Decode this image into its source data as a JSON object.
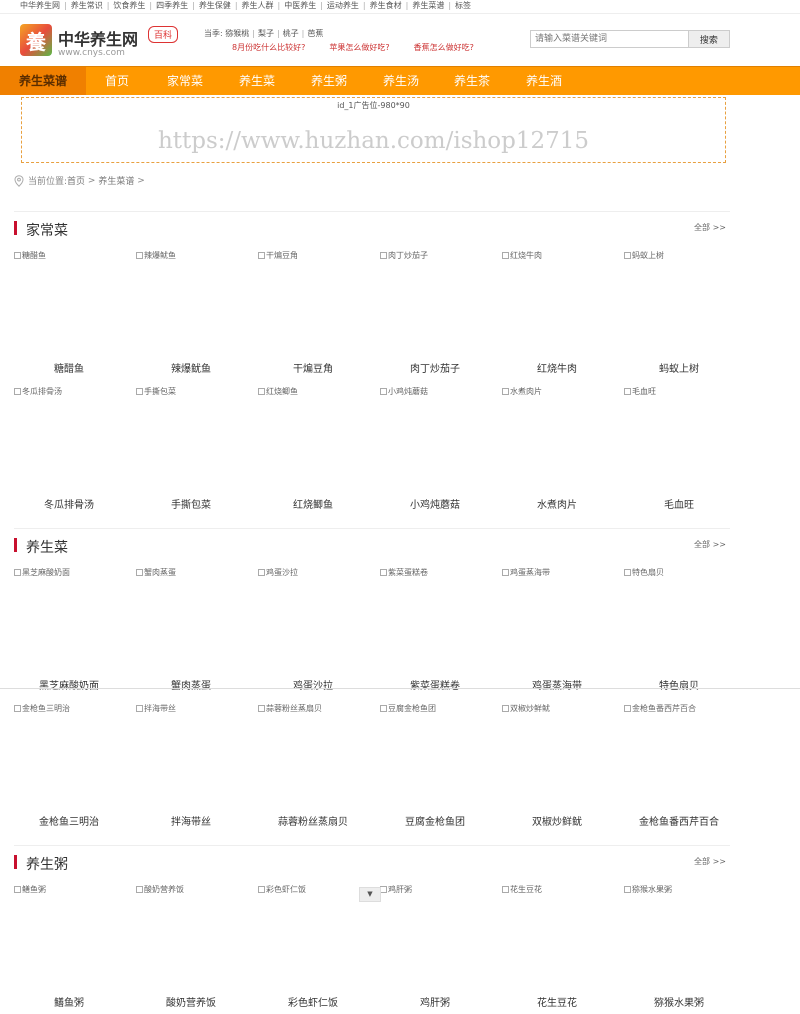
{
  "topbar": [
    "中华养生网",
    "养生常识",
    "饮食养生",
    "四季养生",
    "养生保健",
    "养生人群",
    "中医养生",
    "运动养生",
    "养生食材",
    "养生菜谱",
    "标签"
  ],
  "logo": {
    "mark": "養",
    "name": "中华养生网",
    "url": "www.cnys.com",
    "badge": "百科"
  },
  "hot": {
    "label": "当季:",
    "items": [
      "猕猴桃",
      "梨子",
      "桃子",
      "芭蕉"
    ],
    "questions": [
      "8月份吃什么比较好?",
      "苹果怎么做好吃?",
      "香蕉怎么做好吃?"
    ]
  },
  "search": {
    "placeholder": "请输入菜谱关键词",
    "button": "搜索"
  },
  "nav": [
    "养生菜谱",
    "首页",
    "家常菜",
    "养生菜",
    "养生粥",
    "养生汤",
    "养生茶",
    "养生酒"
  ],
  "ad": {
    "label": "id_1广告位-980*90",
    "watermark": "https://www.huzhan.com/ishop12715"
  },
  "breadcrumb": {
    "prefix": "当前位置:",
    "home": "首页",
    "sep": " > ",
    "current": "养生菜谱",
    "trail": " >"
  },
  "sections": [
    {
      "title": "家常菜",
      "more": "全部 >>",
      "rows": [
        [
          "糖醋鱼",
          "辣爆鱿鱼",
          "干煸豆角",
          "肉丁炒茄子",
          "红烧牛肉",
          "蚂蚁上树"
        ],
        [
          "冬瓜排骨汤",
          "手撕包菜",
          "红烧鲫鱼",
          "小鸡炖蘑菇",
          "水煮肉片",
          "毛血旺"
        ]
      ]
    },
    {
      "title": "养生菜",
      "more": "全部 >>",
      "rows": [
        [
          "黑芝麻酸奶面",
          "蟹肉蒸蛋",
          "鸡蛋沙拉",
          "紫菜蛋糕卷",
          "鸡蛋蒸海带",
          "特色扇贝"
        ],
        [
          "金枪鱼三明治",
          "拌海带丝",
          "蒜蓉粉丝蒸扇贝",
          "豆腐金枪鱼团",
          "双椒炒鲜鱿",
          "金枪鱼番西芹百合"
        ]
      ]
    },
    {
      "title": "养生粥",
      "more": "全部 >>",
      "rows": [
        [
          "鳝鱼粥",
          "酸奶营养饭",
          "彩色虾仁饭",
          "鸡肝粥",
          "花生豆花",
          "猕猴水果粥"
        ]
      ]
    }
  ],
  "scroll_hint": "▼"
}
